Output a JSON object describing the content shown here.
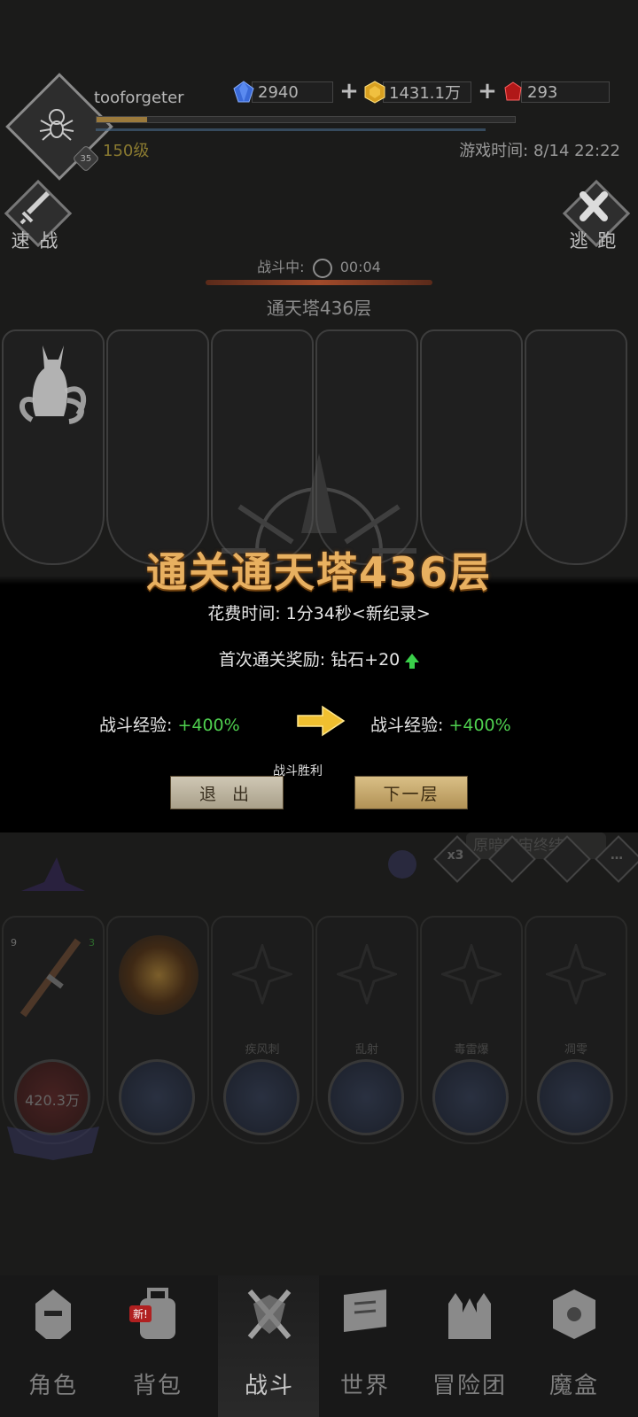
{
  "header": {
    "username": "tooforgeter",
    "level_text": "150级",
    "avatar_badge": "35",
    "game_time": "游戏时间: 8/14 22:22",
    "xp_progress": 0.12,
    "currencies": [
      {
        "name": "diamond",
        "value": "2940",
        "color": "#3a6ad8"
      },
      {
        "name": "gold",
        "value": "1431.1万",
        "color": "#d8a020"
      },
      {
        "name": "ruby",
        "value": "293",
        "color": "#c02020"
      }
    ]
  },
  "side": {
    "quick_battle": "速 战",
    "flee": "逃 跑"
  },
  "battle": {
    "status_label": "战斗中:",
    "timer": "00:04",
    "floor": "通天塔436层"
  },
  "modal": {
    "title": "通关通天塔436层",
    "time_spent": "花费时间:   1分34秒<新纪录>",
    "first_clear_reward": "首次通关奖励: 钻石+20",
    "exp_label": "战斗经验:",
    "exp_before": "+400%",
    "exp_after": "+400%",
    "victory_label": "战斗胜利",
    "exit_button": "退 出",
    "next_button": "下一层"
  },
  "lower": {
    "marquee": "原暗宇宙终结",
    "speed_label": "x3",
    "equip_badge_left": "9",
    "equip_badge_right": "3",
    "skills": [
      {
        "name": "",
        "orb_text": "420.3万"
      },
      {
        "name": "",
        "orb_text": ""
      },
      {
        "name": "疾风刺",
        "orb_text": ""
      },
      {
        "name": "乱射",
        "orb_text": ""
      },
      {
        "name": "毒雷爆",
        "orb_text": ""
      },
      {
        "name": "凋零",
        "orb_text": ""
      }
    ]
  },
  "nav": {
    "items": [
      {
        "label": "角色",
        "icon": "helmet-icon"
      },
      {
        "label": "背包",
        "icon": "backpack-icon"
      },
      {
        "label": "战斗",
        "icon": "crossed-swords-icon"
      },
      {
        "label": "世界",
        "icon": "scroll-map-icon"
      },
      {
        "label": "冒险团",
        "icon": "castle-icon"
      },
      {
        "label": "魔盒",
        "icon": "magic-box-icon"
      }
    ],
    "new_badge": "新!"
  }
}
